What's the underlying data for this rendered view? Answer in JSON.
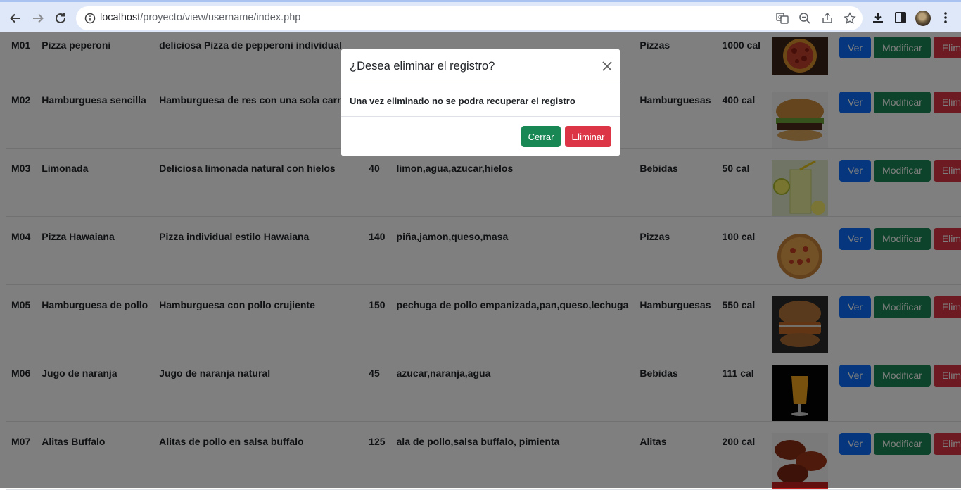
{
  "browser": {
    "url_host": "localhost",
    "url_path": "/proyecto/view/username/index.php"
  },
  "table": {
    "rows": [
      {
        "id": "M01",
        "name": "Pizza peperoni",
        "desc": "deliciosa Pizza de pepperoni individual",
        "price": "",
        "ingredients": "",
        "category": "Pizzas",
        "cal": "1000 cal",
        "img": "pizza"
      },
      {
        "id": "M02",
        "name": "Hamburguesa sencilla",
        "desc": "Hamburguesa de res con una sola carne de re",
        "price": "",
        "ingredients": "",
        "category": "Hamburguesas",
        "cal": "400 cal",
        "img": "burger"
      },
      {
        "id": "M03",
        "name": "Limonada",
        "desc": "Deliciosa limonada natural con hielos",
        "price": "40",
        "ingredients": "limon,agua,azucar,hielos",
        "category": "Bebidas",
        "cal": "50 cal",
        "img": "lemonade"
      },
      {
        "id": "M04",
        "name": "Pizza Hawaiana",
        "desc": "Pizza individual estilo Hawaiana",
        "price": "140",
        "ingredients": "piña,jamon,queso,masa",
        "category": "Pizzas",
        "cal": "100 cal",
        "img": "pizza2"
      },
      {
        "id": "M05",
        "name": "Hamburguesa de pollo",
        "desc": "Hamburguesa con pollo crujiente",
        "price": "150",
        "ingredients": "pechuga de pollo empanizada,pan,queso,lechuga",
        "category": "Hamburguesas",
        "cal": "550 cal",
        "img": "chicken-burger"
      },
      {
        "id": "M06",
        "name": "Jugo de naranja",
        "desc": "Jugo de naranja natural",
        "price": "45",
        "ingredients": "azucar,naranja,agua",
        "category": "Bebidas",
        "cal": "111 cal",
        "img": "orange-juice"
      },
      {
        "id": "M07",
        "name": "Alitas Buffalo",
        "desc": "Alitas de pollo en salsa buffalo",
        "price": "125",
        "ingredients": "ala de pollo,salsa buffalo, pimienta",
        "category": "Alitas",
        "cal": "200 cal",
        "img": "wings"
      }
    ],
    "btn_ver": "Ver",
    "btn_modificar": "Modificar",
    "btn_eliminar": "Eliminar"
  },
  "modal": {
    "title": "¿Desea eliminar el registro?",
    "body": "Una vez eliminado no se podra recuperar el registro",
    "close_label": "Cerrar",
    "delete_label": "Eliminar"
  },
  "colors": {
    "primary": "#0d6efd",
    "success": "#198754",
    "danger": "#dc3545"
  }
}
